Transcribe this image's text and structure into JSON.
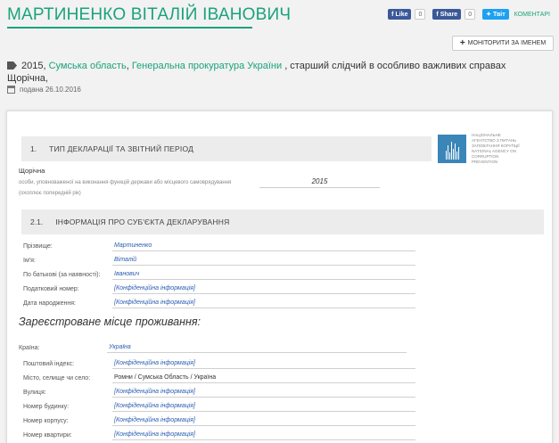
{
  "header": {
    "title": "МАРТИНЕНКО ВІТАЛІЙ ІВАНОВИЧ",
    "social": {
      "fb_like_label": "Like",
      "fb_like_count": "0",
      "fb_share_label": "Share",
      "fb_share_count": "0",
      "tw_label": "Твіт",
      "comments_label": "КОМЕНТАРІ"
    },
    "monitor_button": "МОНІТОРИТИ ЗА ІМЕНЕМ"
  },
  "meta": {
    "year": "2015",
    "region": "Сумська область",
    "organization": "Генеральна прокуратура України",
    "position": ", старший слідчий в особливо важливих справах Щорічна,",
    "submitted": "подана 26.10.2016"
  },
  "document": {
    "section1": {
      "number": "1.",
      "title": "ТИП ДЕКЛАРАЦІЇ ТА ЗВІТНИЙ ПЕРІОД",
      "decl_type": "Щорічна",
      "note": "особи, уповноваженої на виконання функцій держави або місцевого самоврядування (охоплює попередній рік)",
      "year": "2015"
    },
    "agency": {
      "name": "НАЦІОНАЛЬНЕ АГЕНТСТВО З ПИТАНЬ ЗАПОБІГАННЯ КОРУПЦІЇ NATIONAL AGENCY ON CORRUPTION PREVENTION"
    },
    "section2": {
      "number": "2.1.",
      "title": "ІНФОРМАЦІЯ ПРО СУБ'ЄКТА ДЕКЛАРУВАННЯ",
      "fields": [
        {
          "label": "Прізвище:",
          "value": "Мартиненко"
        },
        {
          "label": "Ім'я:",
          "value": "Віталій"
        },
        {
          "label": "По батькові (за наявності):",
          "value": "Іванович"
        },
        {
          "label": "Податковий номер:",
          "value": "[Конфіденційна інформація]"
        },
        {
          "label": "Дата народження:",
          "value": "[Конфіденційна інформація]"
        }
      ]
    },
    "residence": {
      "title": "Зареєстроване місце проживання:",
      "country_label": "Країна:",
      "country_value": "Україна",
      "fields": [
        {
          "label": "Поштовий індекс:",
          "value": "[Конфіденційна інформація]"
        },
        {
          "label": "Місто, селище чи село:",
          "value": "Ромни / Сумська Область / Україна"
        },
        {
          "label": "Вулиця:",
          "value": "[Конфіденційна інформація]"
        },
        {
          "label": "Номер будинку:",
          "value": "[Конфіденційна інформація]"
        },
        {
          "label": "Номер корпусу:",
          "value": "[Конфіденційна інформація]"
        },
        {
          "label": "Номер квартири:",
          "value": "[Конфіденційна інформація]"
        }
      ]
    }
  },
  "colors": {
    "accent": "#1aa37a",
    "facebook": "#3b5998",
    "twitter": "#1da1f2",
    "value_text": "#2a5db0"
  },
  "icons": [
    "tag-icon",
    "calendar-icon",
    "plus-icon",
    "facebook-icon",
    "twitter-icon",
    "agency-logo"
  ]
}
